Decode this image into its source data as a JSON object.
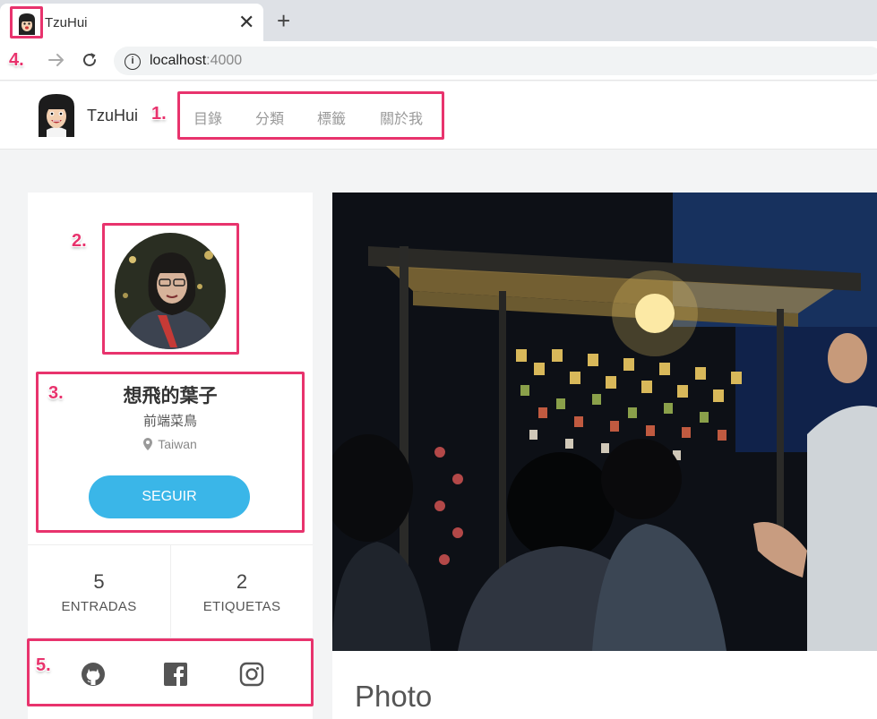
{
  "browser": {
    "tab_title": "TzuHui",
    "url_host": "localhost",
    "url_port": ":4000"
  },
  "site": {
    "title": "TzuHui",
    "nav": [
      "目錄",
      "分類",
      "標籤",
      "關於我"
    ]
  },
  "author": {
    "name": "想飛的葉子",
    "bio": "前端菜鳥",
    "location": "Taiwan",
    "follow_label": "SEGUIR"
  },
  "stats": [
    {
      "count": "5",
      "label": "ENTRADAS"
    },
    {
      "count": "2",
      "label": "ETIQUETAS"
    }
  ],
  "social": [
    "github-icon",
    "facebook-icon",
    "instagram-icon"
  ],
  "post": {
    "title": "Photo"
  },
  "annotations": [
    "1.",
    "2.",
    "3.",
    "4.",
    "5."
  ],
  "colors": {
    "accent": "#3ab6e8",
    "annotation": "#e8336d"
  }
}
